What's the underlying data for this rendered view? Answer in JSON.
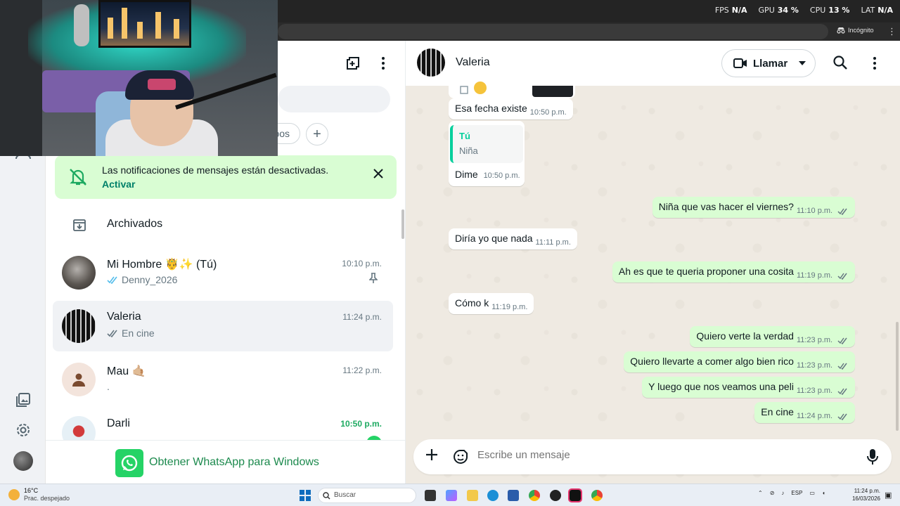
{
  "overlay": {
    "fps_label": "FPS",
    "fps_value": "N/A",
    "gpu_label": "GPU",
    "gpu_value": "34 %",
    "cpu_label": "CPU",
    "cpu_value": "13 %",
    "lat_label": "LAT",
    "lat_value": "N/A"
  },
  "browser": {
    "incognito_label": "Incógnito"
  },
  "chat_list": {
    "filter_chip_partial": "pos",
    "notification": {
      "text": "Las notificaciones de mensajes están desactivadas.",
      "action": "Activar"
    },
    "archived_label": "Archivados",
    "chats": [
      {
        "name": "Mi Hombre 🤴✨ (Tú)",
        "time": "10:10 p.m.",
        "last": "Denny_2026",
        "ticks": "read",
        "pinned": true
      },
      {
        "name": "Valeria",
        "time": "11:24 p.m.",
        "last": "En cine",
        "ticks": "delivered",
        "active": true
      },
      {
        "name": "Mau 🤙🏼",
        "time": "11:22 p.m.",
        "last": "."
      },
      {
        "name": "Darli",
        "time": "10:50 p.m.",
        "time_unread": true
      }
    ],
    "get_app_label": "Obtener WhatsApp para Windows"
  },
  "conversation": {
    "contact_name": "Valeria",
    "call_label": "Llamar",
    "messages": [
      {
        "dir": "in",
        "text": "Esa fecha existe",
        "time": "10:50 p.m."
      },
      {
        "dir": "in",
        "quote_author": "Tú",
        "quote_text": "Niña",
        "text": "Dime",
        "time": "10:50 p.m."
      },
      {
        "dir": "out",
        "text": "Niña que vas hacer el viernes?",
        "time": "11:10 p.m."
      },
      {
        "dir": "in",
        "text": "Diría yo que nada",
        "time": "11:11 p.m."
      },
      {
        "dir": "out",
        "text": "Ah es que te queria proponer una cosita",
        "time": "11:19 p.m."
      },
      {
        "dir": "in",
        "text": "Cómo k",
        "time": "11:19 p.m."
      },
      {
        "dir": "out",
        "text": "Quiero verte la verdad",
        "time": "11:23 p.m."
      },
      {
        "dir": "out",
        "text": "Quiero llevarte a comer algo bien rico",
        "time": "11:23 p.m."
      },
      {
        "dir": "out",
        "text": "Y luego que nos veamos una peli",
        "time": "11:23 p.m."
      },
      {
        "dir": "out",
        "text": "En cine",
        "time": "11:24 p.m."
      }
    ],
    "composer_placeholder": "Escribe un mensaje"
  },
  "taskbar": {
    "weather_temp": "16°C",
    "weather_desc": "Prac. despejado",
    "search_label": "Buscar",
    "lang": "ESP",
    "time": "11:24 p.m.",
    "date": "16/03/2026"
  },
  "colors": {
    "accent_green": "#008069",
    "bubble_out": "#d9fdd3",
    "read_tick": "#53bdeb"
  }
}
